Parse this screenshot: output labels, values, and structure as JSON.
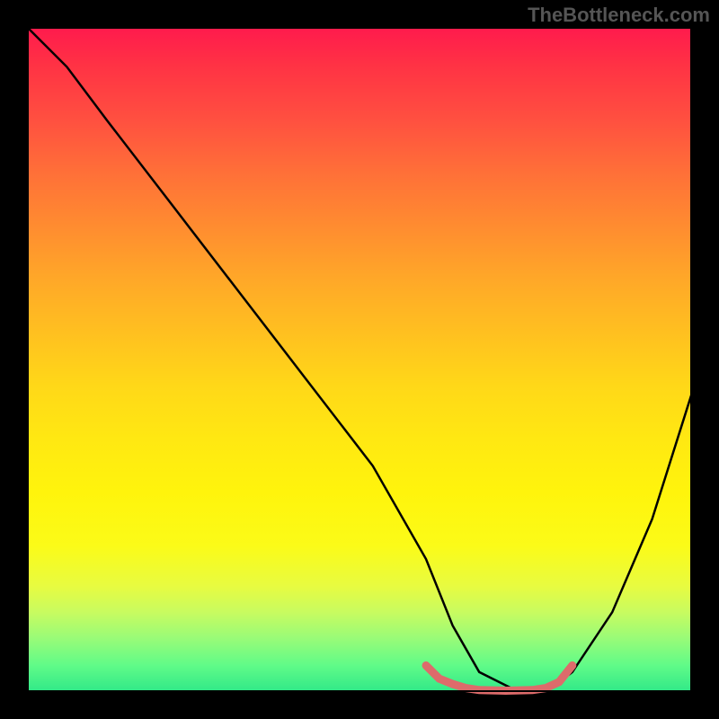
{
  "watermark": "TheBottleneck.com",
  "chart_data": {
    "type": "line",
    "title": "",
    "xlabel": "",
    "ylabel": "",
    "xlim": [
      0,
      100
    ],
    "ylim": [
      0,
      100
    ],
    "background_gradient": [
      "#ff1a4d",
      "#ffd818",
      "#30e888"
    ],
    "series": [
      {
        "name": "main-curve",
        "color": "#000000",
        "x": [
          0,
          6,
          12,
          22,
          32,
          42,
          52,
          60,
          64,
          68,
          74,
          78,
          82,
          88,
          94,
          100
        ],
        "y": [
          100,
          94,
          86,
          73,
          60,
          47,
          34,
          20,
          10,
          3,
          0,
          0,
          3,
          12,
          26,
          45
        ]
      },
      {
        "name": "highlight-segment",
        "color": "#e06666",
        "x": [
          60,
          62,
          64,
          66,
          68,
          72,
          76,
          78,
          80,
          82
        ],
        "y": [
          4,
          2,
          1.2,
          0.6,
          0.3,
          0.2,
          0.3,
          0.6,
          1.5,
          4
        ]
      }
    ],
    "annotations": []
  }
}
